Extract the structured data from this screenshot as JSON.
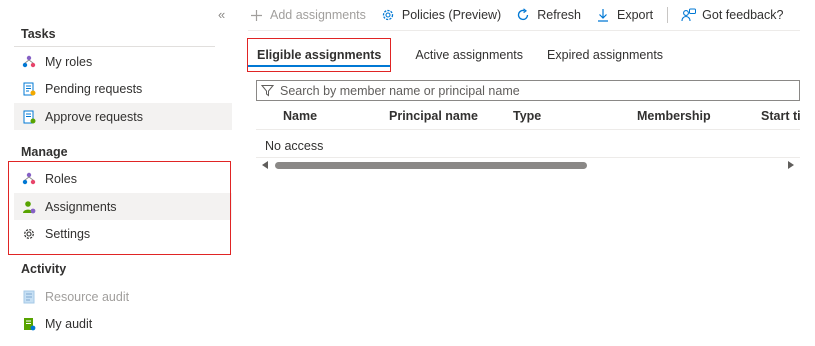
{
  "sidebar": {
    "collapse_glyph": "«",
    "tasks": {
      "title": "Tasks",
      "items": [
        {
          "label": "My roles",
          "icon": "my-roles-icon"
        },
        {
          "label": "Pending requests",
          "icon": "pending-requests-icon"
        },
        {
          "label": "Approve requests",
          "icon": "approve-requests-icon"
        }
      ]
    },
    "manage": {
      "title": "Manage",
      "items": [
        {
          "label": "Roles",
          "icon": "roles-icon"
        },
        {
          "label": "Assignments",
          "icon": "assignments-icon",
          "selected": true
        },
        {
          "label": "Settings",
          "icon": "gear-icon"
        }
      ]
    },
    "activity": {
      "title": "Activity",
      "items": [
        {
          "label": "Resource audit",
          "icon": "resource-audit-icon",
          "disabled": true
        },
        {
          "label": "My audit",
          "icon": "my-audit-icon"
        }
      ]
    }
  },
  "toolbar": {
    "add": "Add assignments",
    "policies": "Policies (Preview)",
    "refresh": "Refresh",
    "export": "Export",
    "feedback": "Got feedback?"
  },
  "tabs": [
    "Eligible assignments",
    "Active assignments",
    "Expired assignments"
  ],
  "active_tab": "Eligible assignments",
  "search": {
    "placeholder": "Search by member name or principal name",
    "value": ""
  },
  "table": {
    "columns": [
      "Name",
      "Principal name",
      "Type",
      "Membership",
      "Start time"
    ],
    "empty_text": "No access"
  },
  "colors": {
    "accent": "#0078d4",
    "highlight_box": "#e02424"
  }
}
